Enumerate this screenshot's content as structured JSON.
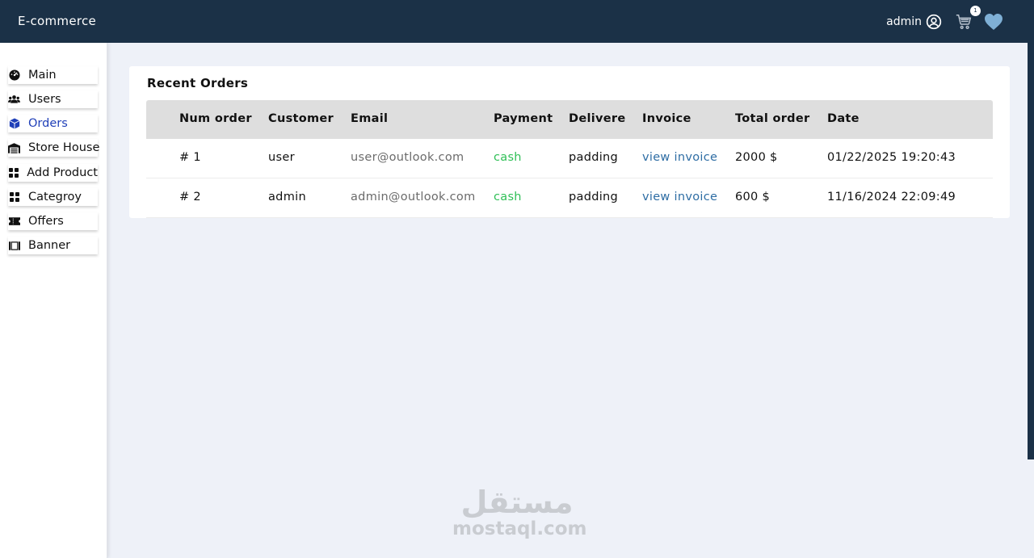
{
  "header": {
    "brand": "E-commerce",
    "user_label": "admin",
    "cart_count": "1",
    "icons": [
      "user-circle-icon",
      "cart-icon",
      "heart-icon"
    ],
    "colors": {
      "bar": "#1b3147",
      "heart": "#7fb0d6"
    }
  },
  "sidebar": {
    "items": [
      {
        "label": "Main",
        "icon": "dashboard-icon",
        "active": false
      },
      {
        "label": "Users",
        "icon": "users-icon",
        "active": false
      },
      {
        "label": "Orders",
        "icon": "box-icon",
        "active": true
      },
      {
        "label": "Store House",
        "icon": "warehouse-icon",
        "active": false
      },
      {
        "label": "Add Product",
        "icon": "grid-icon",
        "active": false
      },
      {
        "label": "Categroy",
        "icon": "grid-icon",
        "active": false
      },
      {
        "label": "Offers",
        "icon": "ticket-icon",
        "active": false
      },
      {
        "label": "Banner",
        "icon": "banner-icon",
        "active": false
      }
    ],
    "active_color": "#1f3fb8"
  },
  "orders": {
    "title": "Recent Orders",
    "columns": [
      "Num order",
      "Customer",
      "Email",
      "Payment",
      "Delivere",
      "Invoice",
      "Total order",
      "Date"
    ],
    "rows": [
      {
        "num": "# 1",
        "customer": "user",
        "email": "user@outlook.com",
        "payment": "cash",
        "delivery": "padding",
        "invoice": "view invoice",
        "total": "2000 $",
        "date": "01/22/2025 19:20:43"
      },
      {
        "num": "# 2",
        "customer": "admin",
        "email": "admin@outlook.com",
        "payment": "cash",
        "delivery": "padding",
        "invoice": "view invoice",
        "total": "600 $",
        "date": "11/16/2024 22:09:49"
      }
    ]
  },
  "watermark": {
    "arabic": "مستقل",
    "latin": "mostaql.com"
  }
}
